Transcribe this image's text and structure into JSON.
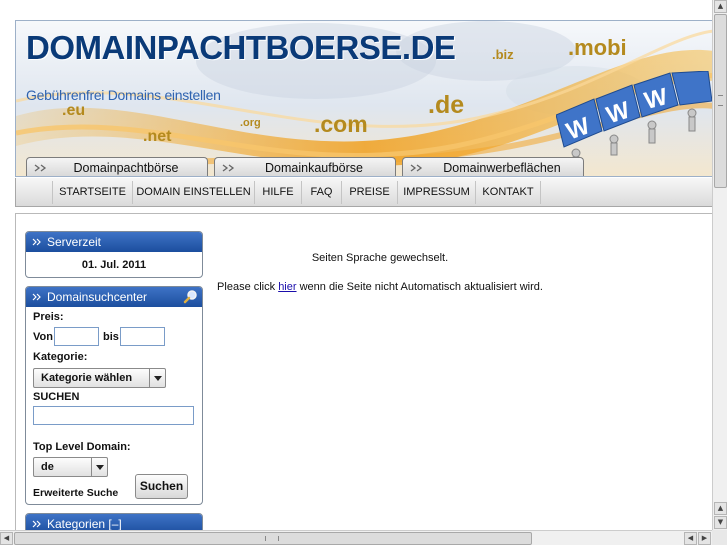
{
  "header": {
    "title": "DOMAINPACHTBOERSE.DE",
    "subtitle": "Gebührenfrei Domains einstellen",
    "tlds": [
      ".eu",
      ".net",
      ".org",
      ".com",
      ".de",
      ".biz",
      ".mobi"
    ],
    "logo_text": "WWW"
  },
  "main_tabs": [
    {
      "label": "Domainpachtbörse"
    },
    {
      "label": "Domainkaufbörse"
    },
    {
      "label": "Domainwerbeflächen"
    }
  ],
  "nav": [
    {
      "label": "STARTSEITE"
    },
    {
      "label": "DOMAIN EINSTELLEN"
    },
    {
      "label": "HILFE"
    },
    {
      "label": "FAQ"
    },
    {
      "label": "PREISE"
    },
    {
      "label": "IMPRESSUM"
    },
    {
      "label": "KONTAKT"
    }
  ],
  "serverzeit": {
    "title": "Serverzeit",
    "date": "01. Jul. 2011"
  },
  "search": {
    "title": "Domainsuchcenter",
    "preis_label": "Preis:",
    "von_label": "Von",
    "bis_label": "bis",
    "von_value": "",
    "bis_value": "",
    "kategorie_label": "Kategorie:",
    "kategorie_selected": "Kategorie wählen",
    "suchen_label": "SUCHEN",
    "suchen_value": "",
    "tld_label": "Top Level Domain:",
    "tld_selected": "de",
    "advanced_label": "Erweiterte Suche",
    "button_label": "Suchen"
  },
  "kategorien": {
    "title": "Kategorien [–]"
  },
  "message": {
    "line1": "Seiten Sprache gewechselt.",
    "line2_before": "Please click ",
    "line2_link": "hier",
    "line2_after": " wenn die Seite nicht Automatisch aktualisiert wird."
  },
  "colors": {
    "title_blue": "#0a3a78",
    "box_header_blue": "#2a5fb4",
    "tld_gold": "#b48a1e",
    "logo_blue": "#3f74c8",
    "link": "#1a0dab"
  }
}
